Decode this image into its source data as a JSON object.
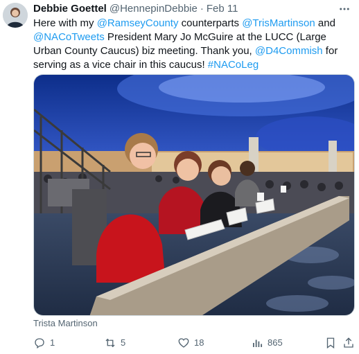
{
  "tweet": {
    "author_name": "Debbie Goettel",
    "author_handle": "@HennepinDebbie",
    "separator": "·",
    "date": "Feb 11",
    "text_parts": {
      "t1": "Here with my ",
      "l1": "@RamseyCounty",
      "t2": " counterparts ",
      "l2": "@TrisMartinson",
      "t3": " and ",
      "l3": "@NACoTweets",
      "t4": " President Mary Jo McGuire at the LUCC (Large Urban County Caucus) biz meeting. Thank you, ",
      "l4": "@D4Commish",
      "t5": " for serving as a vice chair in this caucus! ",
      "l5": "#NACoLeg"
    },
    "media_caption": "Trista Martinson",
    "actions": {
      "replies": "1",
      "reposts": "5",
      "likes": "18",
      "views": "865"
    }
  },
  "colors": {
    "text": "#0f1419",
    "secondary": "#536471",
    "link": "#1d9bf0"
  },
  "icons": [
    "more-icon",
    "reply-icon",
    "repost-icon",
    "like-icon",
    "views-icon",
    "bookmark-icon",
    "share-icon"
  ]
}
